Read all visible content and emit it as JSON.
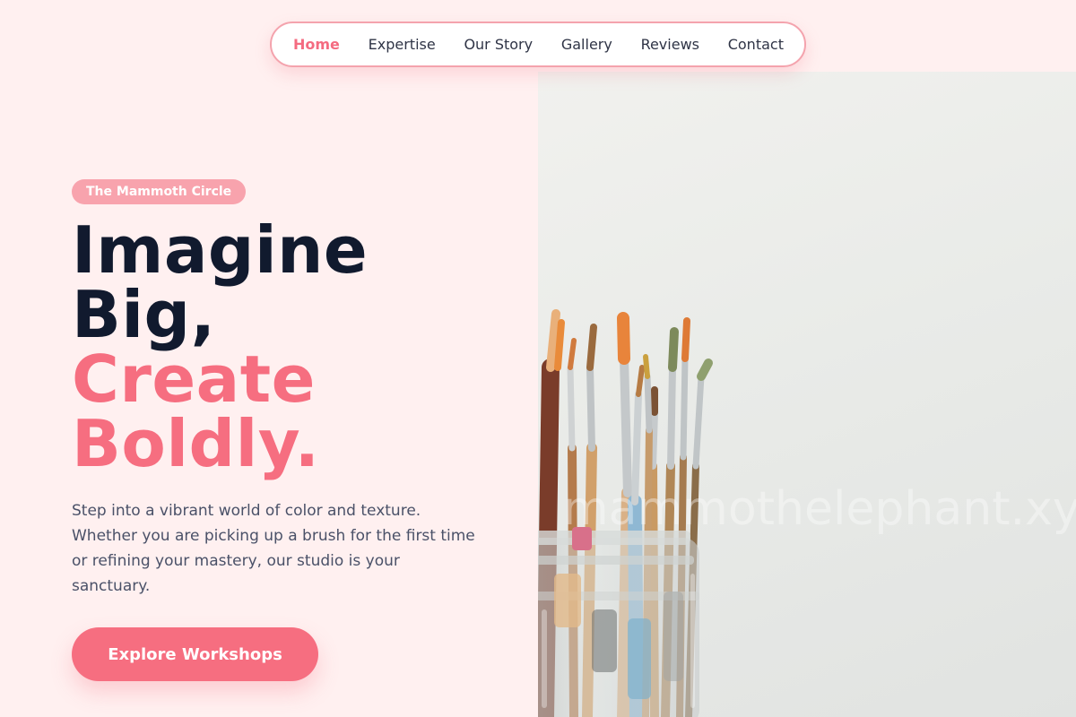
{
  "nav": {
    "items": [
      {
        "label": "Home",
        "active": true
      },
      {
        "label": "Expertise",
        "active": false
      },
      {
        "label": "Our Story",
        "active": false
      },
      {
        "label": "Gallery",
        "active": false
      },
      {
        "label": "Reviews",
        "active": false
      },
      {
        "label": "Contact",
        "active": false
      }
    ]
  },
  "hero": {
    "badge": "The Mammoth Circle",
    "headline_dark_1": "Imagine",
    "headline_dark_2": "Big,",
    "headline_pink_1": "Create",
    "headline_pink_2": "Boldly.",
    "intro": "Step into a vibrant world of color and texture. Whether you are picking up a brush for the first time or refining your mastery, our studio is your sanctuary.",
    "cta_label": "Explore Workshops"
  },
  "image": {
    "watermark": "mammothelephant.xyz"
  },
  "colors": {
    "accent": "#f66e80",
    "badge": "#f8a3ad",
    "heading": "#111a2e",
    "background": "#fff0f0"
  }
}
